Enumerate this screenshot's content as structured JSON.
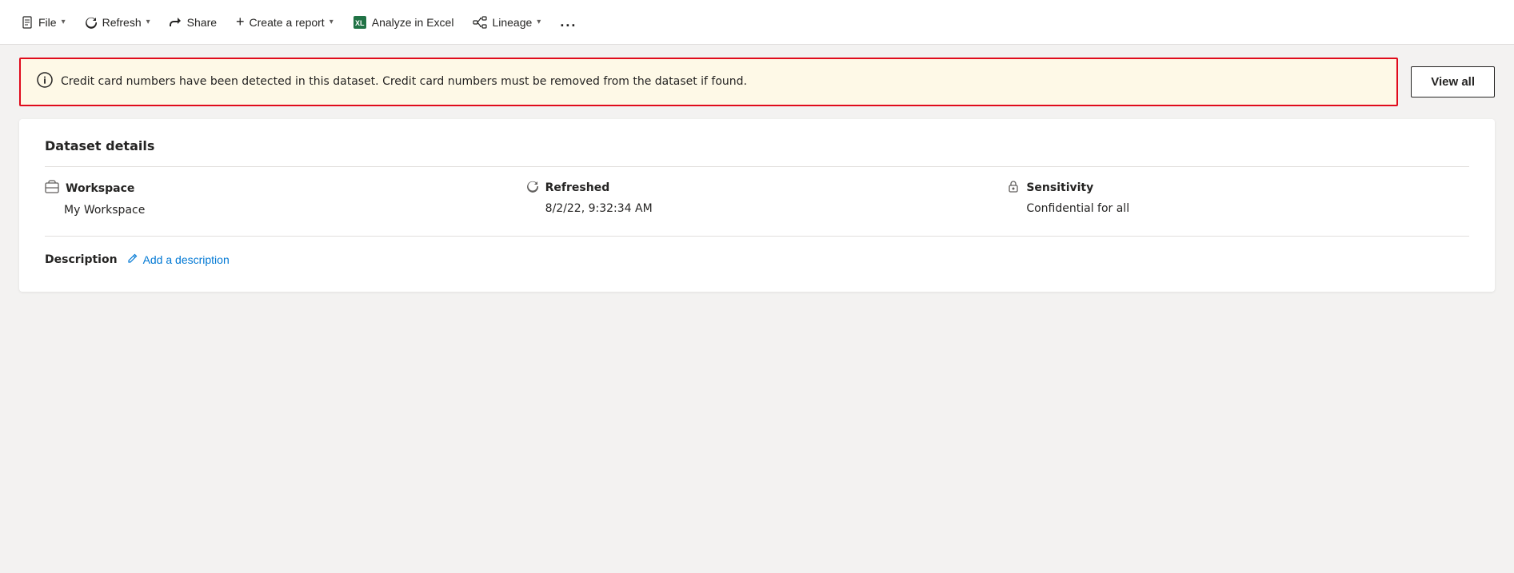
{
  "toolbar": {
    "file_label": "File",
    "refresh_label": "Refresh",
    "share_label": "Share",
    "create_report_label": "Create a report",
    "analyze_excel_label": "Analyze in Excel",
    "lineage_label": "Lineage",
    "more_label": "..."
  },
  "alert": {
    "message": "Credit card numbers have been detected in this dataset. Credit card numbers must be removed from the dataset if found.",
    "view_all_label": "View all"
  },
  "dataset_details": {
    "section_title": "Dataset details",
    "workspace_label": "Workspace",
    "workspace_value": "My Workspace",
    "refreshed_label": "Refreshed",
    "refreshed_value": "8/2/22, 9:32:34 AM",
    "sensitivity_label": "Sensitivity",
    "sensitivity_value": "Confidential for all",
    "description_label": "Description",
    "add_description_label": "Add a description"
  }
}
